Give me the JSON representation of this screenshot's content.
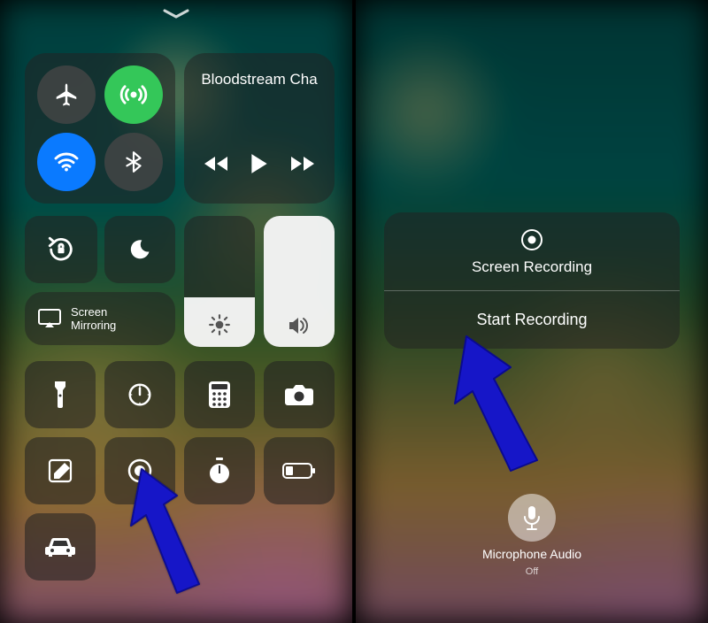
{
  "music": {
    "title": "Bloodstream Cha"
  },
  "screen_mirroring": {
    "label": "Screen\nMirroring"
  },
  "brightness": {
    "percent": 38
  },
  "volume": {
    "percent": 100
  },
  "recording_sheet": {
    "title": "Screen Recording",
    "action": "Start Recording"
  },
  "microphone": {
    "label": "Microphone Audio",
    "state": "Off"
  },
  "icons": {
    "airplane": "airplane-icon",
    "cellular": "cellular-icon",
    "wifi": "wifi-icon",
    "bluetooth": "bluetooth-icon",
    "rewind": "rewind-icon",
    "play": "play-icon",
    "ffwd": "fast-forward-icon",
    "rotation_lock": "rotation-lock-icon",
    "dnd": "moon-icon",
    "airplay": "airplay-icon",
    "brightness": "sun-icon",
    "volume": "speaker-icon",
    "flashlight": "flashlight-icon",
    "timer": "timer-icon",
    "calculator": "calculator-icon",
    "camera": "camera-icon",
    "note": "note-icon",
    "record": "record-icon",
    "stopwatch": "stopwatch-icon",
    "low_power": "low-power-icon",
    "car": "car-icon",
    "microphone": "microphone-icon"
  },
  "colors": {
    "active_green": "#34c759",
    "active_blue": "#0a7aff",
    "panel": "rgba(35,35,35,0.55)",
    "arrow": "#1616c8"
  }
}
